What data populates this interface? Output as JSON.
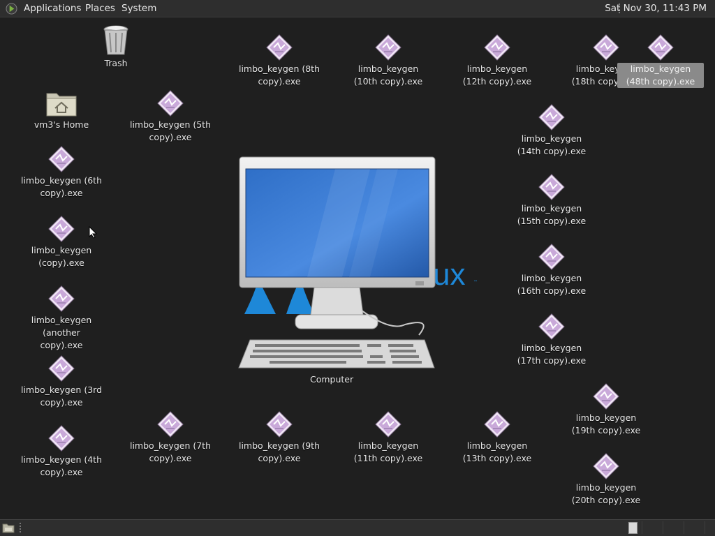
{
  "topbar": {
    "menus": [
      "Applications",
      "Places",
      "System"
    ],
    "clock": "Sat Nov 30, 11:43 PM"
  },
  "desktop": {
    "trash": "Trash",
    "home": "vm3's Home",
    "computer": "Computer",
    "wallpaper_fragment": "ux",
    "exe_icons": [
      "limbo_keygen (5th copy).exe",
      "limbo_keygen (6th copy).exe",
      "limbo_keygen (copy).exe",
      "limbo_keygen (another copy).exe",
      "limbo_keygen (3rd copy).exe",
      "limbo_keygen (4th copy).exe",
      "limbo_keygen (7th copy).exe",
      "limbo_keygen (8th copy).exe",
      "limbo_keygen (9th copy).exe",
      "limbo_keygen (10th copy).exe",
      "limbo_keygen (11th copy).exe",
      "limbo_keygen (12th copy).exe",
      "limbo_keygen (13th copy).exe",
      "limbo_keygen (14th copy).exe",
      "limbo_keygen (15th copy).exe",
      "limbo_keygen (16th copy).exe",
      "limbo_keygen (17th copy).exe",
      "limbo_keygen (18th copy).exe",
      "limbo_keygen (19th copy).exe",
      "limbo_keygen (20th copy).exe",
      "limbo_keygen (48th copy).exe"
    ],
    "selected_icon": "limbo_keygen (48th copy).exe"
  },
  "icons_semantic": {
    "menu_logo": "app-menu-icon",
    "trash": "trash-icon",
    "home": "home-folder-icon",
    "exe": "exe-file-icon",
    "computer": "computer-icon",
    "show_desktop": "show-desktop-icon",
    "cursor": "mouse-cursor-icon"
  },
  "colors": {
    "background": "#1f1f1f",
    "panel": "#2e2e2e",
    "selection": "#8a8a8a",
    "exe_icon": "#c9a9d9",
    "accent_blue": "#1e88d8"
  }
}
